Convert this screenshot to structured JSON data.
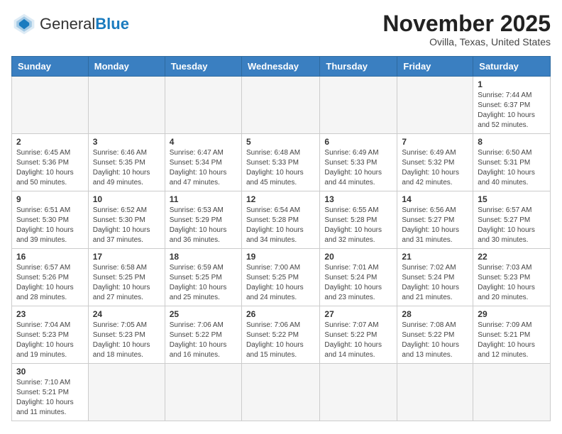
{
  "logo": {
    "general": "General",
    "blue": "Blue"
  },
  "title": {
    "month_year": "November 2025",
    "location": "Ovilla, Texas, United States"
  },
  "headers": [
    "Sunday",
    "Monday",
    "Tuesday",
    "Wednesday",
    "Thursday",
    "Friday",
    "Saturday"
  ],
  "weeks": [
    [
      {
        "day": "",
        "info": ""
      },
      {
        "day": "",
        "info": ""
      },
      {
        "day": "",
        "info": ""
      },
      {
        "day": "",
        "info": ""
      },
      {
        "day": "",
        "info": ""
      },
      {
        "day": "",
        "info": ""
      },
      {
        "day": "1",
        "info": "Sunrise: 7:44 AM\nSunset: 6:37 PM\nDaylight: 10 hours and 52 minutes."
      }
    ],
    [
      {
        "day": "2",
        "info": "Sunrise: 6:45 AM\nSunset: 5:36 PM\nDaylight: 10 hours and 50 minutes."
      },
      {
        "day": "3",
        "info": "Sunrise: 6:46 AM\nSunset: 5:35 PM\nDaylight: 10 hours and 49 minutes."
      },
      {
        "day": "4",
        "info": "Sunrise: 6:47 AM\nSunset: 5:34 PM\nDaylight: 10 hours and 47 minutes."
      },
      {
        "day": "5",
        "info": "Sunrise: 6:48 AM\nSunset: 5:33 PM\nDaylight: 10 hours and 45 minutes."
      },
      {
        "day": "6",
        "info": "Sunrise: 6:49 AM\nSunset: 5:33 PM\nDaylight: 10 hours and 44 minutes."
      },
      {
        "day": "7",
        "info": "Sunrise: 6:49 AM\nSunset: 5:32 PM\nDaylight: 10 hours and 42 minutes."
      },
      {
        "day": "8",
        "info": "Sunrise: 6:50 AM\nSunset: 5:31 PM\nDaylight: 10 hours and 40 minutes."
      }
    ],
    [
      {
        "day": "9",
        "info": "Sunrise: 6:51 AM\nSunset: 5:30 PM\nDaylight: 10 hours and 39 minutes."
      },
      {
        "day": "10",
        "info": "Sunrise: 6:52 AM\nSunset: 5:30 PM\nDaylight: 10 hours and 37 minutes."
      },
      {
        "day": "11",
        "info": "Sunrise: 6:53 AM\nSunset: 5:29 PM\nDaylight: 10 hours and 36 minutes."
      },
      {
        "day": "12",
        "info": "Sunrise: 6:54 AM\nSunset: 5:28 PM\nDaylight: 10 hours and 34 minutes."
      },
      {
        "day": "13",
        "info": "Sunrise: 6:55 AM\nSunset: 5:28 PM\nDaylight: 10 hours and 32 minutes."
      },
      {
        "day": "14",
        "info": "Sunrise: 6:56 AM\nSunset: 5:27 PM\nDaylight: 10 hours and 31 minutes."
      },
      {
        "day": "15",
        "info": "Sunrise: 6:57 AM\nSunset: 5:27 PM\nDaylight: 10 hours and 30 minutes."
      }
    ],
    [
      {
        "day": "16",
        "info": "Sunrise: 6:57 AM\nSunset: 5:26 PM\nDaylight: 10 hours and 28 minutes."
      },
      {
        "day": "17",
        "info": "Sunrise: 6:58 AM\nSunset: 5:25 PM\nDaylight: 10 hours and 27 minutes."
      },
      {
        "day": "18",
        "info": "Sunrise: 6:59 AM\nSunset: 5:25 PM\nDaylight: 10 hours and 25 minutes."
      },
      {
        "day": "19",
        "info": "Sunrise: 7:00 AM\nSunset: 5:25 PM\nDaylight: 10 hours and 24 minutes."
      },
      {
        "day": "20",
        "info": "Sunrise: 7:01 AM\nSunset: 5:24 PM\nDaylight: 10 hours and 23 minutes."
      },
      {
        "day": "21",
        "info": "Sunrise: 7:02 AM\nSunset: 5:24 PM\nDaylight: 10 hours and 21 minutes."
      },
      {
        "day": "22",
        "info": "Sunrise: 7:03 AM\nSunset: 5:23 PM\nDaylight: 10 hours and 20 minutes."
      }
    ],
    [
      {
        "day": "23",
        "info": "Sunrise: 7:04 AM\nSunset: 5:23 PM\nDaylight: 10 hours and 19 minutes."
      },
      {
        "day": "24",
        "info": "Sunrise: 7:05 AM\nSunset: 5:23 PM\nDaylight: 10 hours and 18 minutes."
      },
      {
        "day": "25",
        "info": "Sunrise: 7:06 AM\nSunset: 5:22 PM\nDaylight: 10 hours and 16 minutes."
      },
      {
        "day": "26",
        "info": "Sunrise: 7:06 AM\nSunset: 5:22 PM\nDaylight: 10 hours and 15 minutes."
      },
      {
        "day": "27",
        "info": "Sunrise: 7:07 AM\nSunset: 5:22 PM\nDaylight: 10 hours and 14 minutes."
      },
      {
        "day": "28",
        "info": "Sunrise: 7:08 AM\nSunset: 5:22 PM\nDaylight: 10 hours and 13 minutes."
      },
      {
        "day": "29",
        "info": "Sunrise: 7:09 AM\nSunset: 5:21 PM\nDaylight: 10 hours and 12 minutes."
      }
    ],
    [
      {
        "day": "30",
        "info": "Sunrise: 7:10 AM\nSunset: 5:21 PM\nDaylight: 10 hours and 11 minutes."
      },
      {
        "day": "",
        "info": ""
      },
      {
        "day": "",
        "info": ""
      },
      {
        "day": "",
        "info": ""
      },
      {
        "day": "",
        "info": ""
      },
      {
        "day": "",
        "info": ""
      },
      {
        "day": "",
        "info": ""
      }
    ]
  ]
}
